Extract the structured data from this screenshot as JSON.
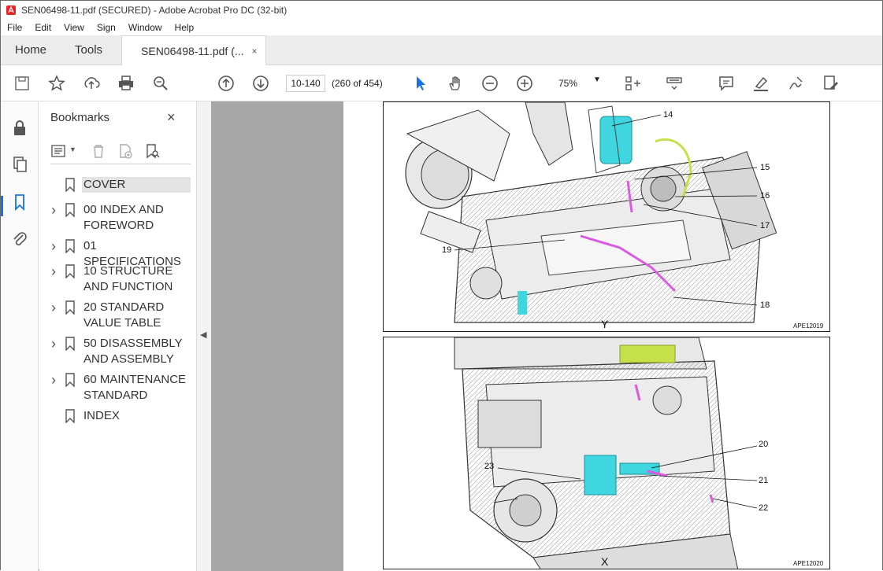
{
  "window": {
    "title": "SEN06498-11.pdf (SECURED) - Adobe Acrobat Pro DC (32-bit)"
  },
  "menu": [
    "File",
    "Edit",
    "View",
    "Sign",
    "Window",
    "Help"
  ],
  "tabs": {
    "home": "Home",
    "tools": "Tools",
    "document": "SEN06498-11.pdf (...",
    "close": "×"
  },
  "toolbar": {
    "page_input": "10-140",
    "page_count": "(260 of 454)",
    "zoom": "75%",
    "icons": [
      "save-icon",
      "bookmark-star-icon",
      "upload-icon",
      "print-icon",
      "find-icon",
      "prev-page-icon",
      "next-page-icon",
      "select-cursor-icon",
      "hand-icon",
      "zoom-out-icon",
      "zoom-in-icon",
      "page-layout-icon",
      "scroll-mode-icon",
      "comment-icon",
      "highlight-icon",
      "sign-icon",
      "fill-sign-icon"
    ]
  },
  "bookmarks": {
    "title": "Bookmarks",
    "close": "×",
    "items": [
      {
        "label": "COVER",
        "expandable": false,
        "selected": true
      },
      {
        "label": "00 INDEX AND FOREWORD",
        "expandable": true
      },
      {
        "label": "01 SPECIFICATIONS",
        "expandable": true
      },
      {
        "label": "10 STRUCTURE AND FUNCTION",
        "expandable": true
      },
      {
        "label": "20 STANDARD VALUE TABLE",
        "expandable": true
      },
      {
        "label": "50 DISASSEMBLY AND ASSEMBLY",
        "expandable": true
      },
      {
        "label": "60 MAINTENANCE STANDARD",
        "expandable": true
      },
      {
        "label": "INDEX",
        "expandable": false
      }
    ]
  },
  "figures": {
    "top": {
      "view": "Y",
      "code": "APE12019",
      "callouts": [
        "14",
        "15",
        "16",
        "17",
        "18",
        "19"
      ]
    },
    "bottom": {
      "view": "X",
      "code": "APE12020",
      "callouts": [
        "20",
        "21",
        "22",
        "23"
      ]
    }
  },
  "colors": {
    "accent": "#1473e6",
    "cyan_part": "#3fd6e0",
    "magenta_part": "#d85be0",
    "yellow_part": "#c6e04a",
    "gutter": "#a7a7a7"
  }
}
